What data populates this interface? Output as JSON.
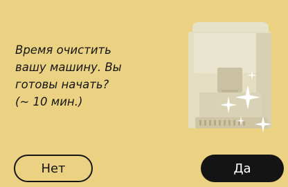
{
  "dialog": {
    "message_lines": [
      "Время очистить",
      "вашу машину. Вы",
      "готовы начать?",
      "(~ 10 мин.)"
    ],
    "illustration": "coffee-machine-with-sparkles-icon",
    "no_button_label": "Нет",
    "yes_button_label": "Да"
  },
  "colors": {
    "background": "#ebd283",
    "text": "#141414",
    "primary_button": "#141414",
    "primary_button_text": "#ffffff",
    "machine_body": "#e3ddc2"
  }
}
